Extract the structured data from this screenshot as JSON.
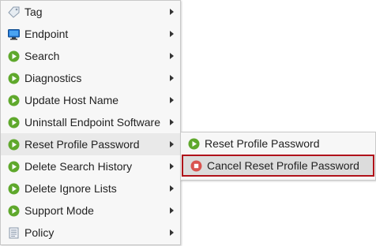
{
  "menu": {
    "items": [
      {
        "label": "Tag",
        "icon": "tag-icon"
      },
      {
        "label": "Endpoint",
        "icon": "monitor-icon"
      },
      {
        "label": "Search",
        "icon": "play-icon"
      },
      {
        "label": "Diagnostics",
        "icon": "play-icon"
      },
      {
        "label": "Update Host Name",
        "icon": "play-icon"
      },
      {
        "label": "Uninstall Endpoint Software",
        "icon": "play-icon"
      },
      {
        "label": "Reset Profile Password",
        "icon": "play-icon"
      },
      {
        "label": "Delete Search History",
        "icon": "play-icon"
      },
      {
        "label": "Delete Ignore Lists",
        "icon": "play-icon"
      },
      {
        "label": "Support Mode",
        "icon": "play-icon"
      },
      {
        "label": "Policy",
        "icon": "policy-icon"
      }
    ]
  },
  "submenu": {
    "items": [
      {
        "label": "Reset Profile Password",
        "icon": "play-icon"
      },
      {
        "label": "Cancel Reset Profile Password",
        "icon": "stop-icon"
      }
    ]
  },
  "colors": {
    "play_icon": "#5fa82c",
    "stop_icon": "#d9534f",
    "selected_border": "#b0121a",
    "menu_bg": "#f7f7f7"
  }
}
